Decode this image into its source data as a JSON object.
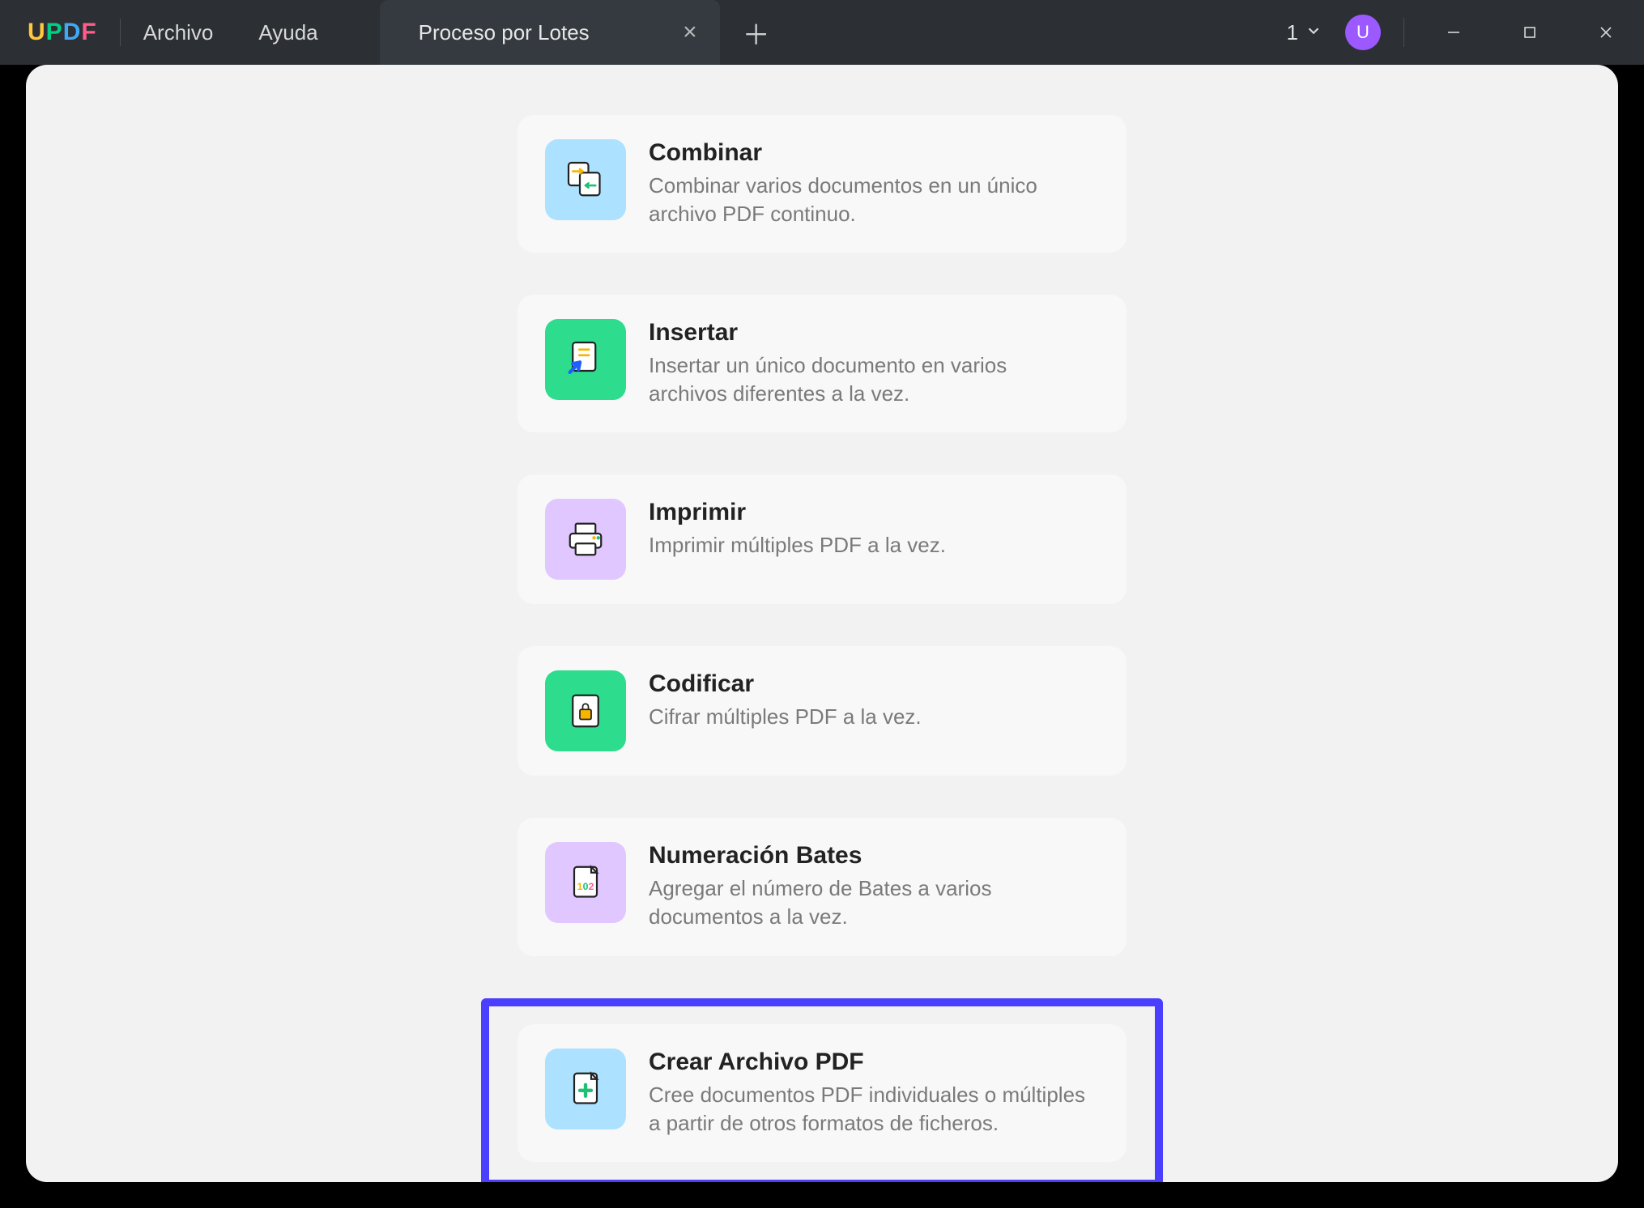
{
  "titlebar": {
    "logo": "UPDF",
    "menu_file": "Archivo",
    "menu_help": "Ayuda",
    "tab_label": "Proceso por Lotes",
    "tabs_count": "1",
    "avatar_initial": "U"
  },
  "cards": {
    "combine": {
      "title": "Combinar",
      "desc": "Combinar varios documentos en un único archivo PDF continuo."
    },
    "insert": {
      "title": "Insertar",
      "desc": "Insertar un único documento en varios archivos diferentes a la vez."
    },
    "print": {
      "title": "Imprimir",
      "desc": "Imprimir múltiples PDF a la vez."
    },
    "encrypt": {
      "title": "Codificar",
      "desc": "Cifrar múltiples PDF a la vez."
    },
    "bates": {
      "title": "Numeración Bates",
      "desc": "Agregar el número de Bates a varios documentos a la vez."
    },
    "create": {
      "title": "Crear Archivo PDF",
      "desc": "Cree documentos PDF individuales o múltiples a partir de otros formatos de ficheros."
    }
  }
}
